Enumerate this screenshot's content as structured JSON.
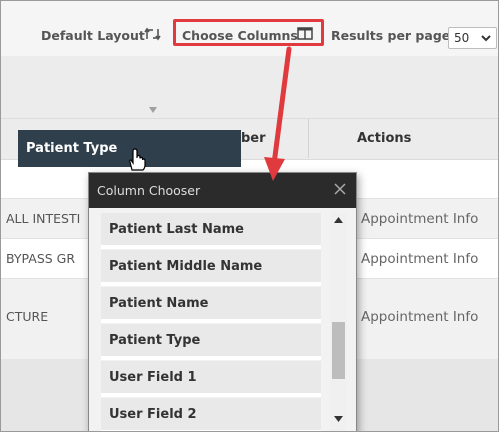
{
  "toolbar": {
    "default_layout_label": "Default Layout",
    "choose_columns_label": "Choose Columns",
    "results_label": "Results per page",
    "results_value": "50"
  },
  "grid": {
    "header_partial": "ber",
    "actions_header": "Actions",
    "rows": [
      {
        "left": "ALL INTESTI",
        "action": "Appointment Info"
      },
      {
        "left": "BYPASS GR",
        "action": "Appointment Info"
      },
      {
        "left": "CTURE",
        "action": "Appointment Info"
      }
    ]
  },
  "drag_header_label": "Patient Type",
  "column_chooser": {
    "title": "Column Chooser",
    "items": [
      "Patient Last Name",
      "Patient Middle Name",
      "Patient Name",
      "Patient Type",
      "User Field 1",
      "User Field 2"
    ]
  },
  "colors": {
    "callout_red": "#e0393e",
    "header_dark": "#2f3f4c",
    "chooser_title": "#2b2b2b"
  }
}
